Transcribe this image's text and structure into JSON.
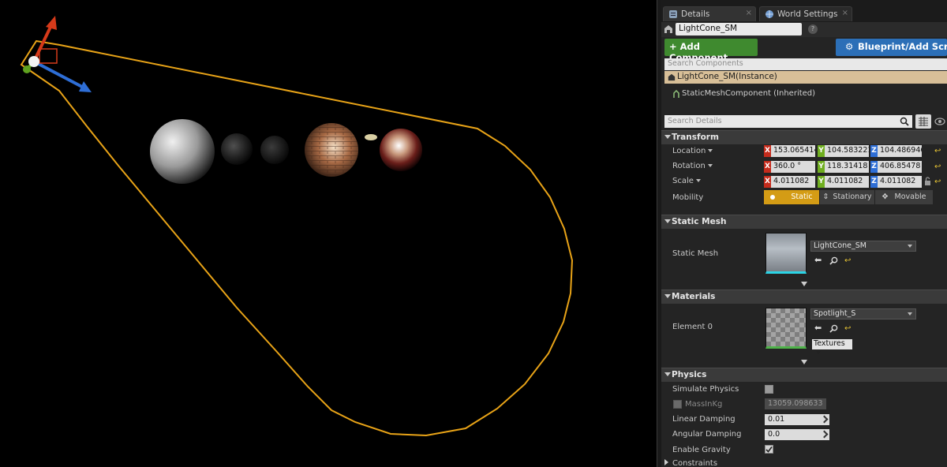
{
  "tabs": [
    {
      "label": "Details",
      "close": "×"
    },
    {
      "label": "World Settings",
      "close": "×"
    }
  ],
  "actor_name": "LightCone_SM",
  "help": "?",
  "buttons": {
    "add_component": "+ Add Component",
    "blueprint": "Blueprint/Add Script"
  },
  "search_components_placeholder": "Search Components",
  "components": {
    "instance": "LightCone_SM(Instance)",
    "static_mesh_component": "StaticMeshComponent (Inherited)"
  },
  "search_details_placeholder": "Search Details",
  "sections": {
    "transform": "Transform",
    "static_mesh": "Static Mesh",
    "materials": "Materials",
    "physics": "Physics",
    "constraints": "Constraints"
  },
  "transform": {
    "location": {
      "label": "Location",
      "x": "153.065414",
      "y": "104.583221",
      "z": "104.486946"
    },
    "rotation": {
      "label": "Rotation",
      "x": "360.0 °",
      "y": "118.31418",
      "z": "406.85478"
    },
    "scale": {
      "label": "Scale",
      "x": "4.011082",
      "y": "4.011082",
      "z": "4.011082"
    },
    "mobility": {
      "label": "Mobility",
      "options": [
        "Static",
        "Stationary",
        "Movable"
      ],
      "selected": "Static"
    }
  },
  "axis_letters": {
    "x": "X",
    "y": "Y",
    "z": "Z"
  },
  "static_mesh": {
    "label": "Static Mesh",
    "asset": "LightCone_SM"
  },
  "materials": {
    "label": "Element 0",
    "asset": "Spotlight_S",
    "textures": "Textures"
  },
  "physics": {
    "simulate_label": "Simulate Physics",
    "simulate_checked": false,
    "mass_label": "MassInKg",
    "mass_value": "13059.098633",
    "linear_label": "Linear Damping",
    "linear_value": "0.01",
    "angular_label": "Angular Damping",
    "angular_value": "0.0",
    "gravity_label": "Enable Gravity",
    "gravity_checked": true
  },
  "colors": {
    "cone_outline": "#e8a317",
    "add_button": "#3f8a2f",
    "blueprint_button": "#2c6fb7",
    "selected_row": "#d8bf98",
    "mobility_active": "#d49c15",
    "axis_x": "#c42b1c",
    "axis_y": "#6fae1f",
    "axis_z": "#2e6ed6"
  }
}
